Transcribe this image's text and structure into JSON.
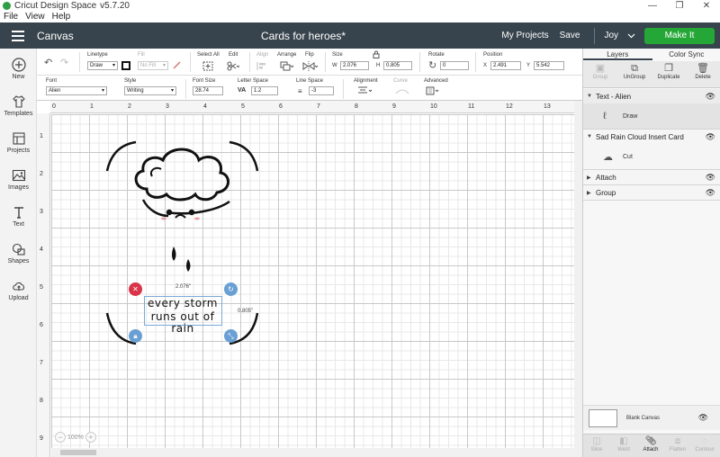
{
  "window": {
    "title": "Cricut Design Space",
    "version": "v5.7.20",
    "controls": [
      "—",
      "❐",
      "✕"
    ]
  },
  "menu": [
    "File",
    "View",
    "Help"
  ],
  "header": {
    "section": "Canvas",
    "doc_title": "Cards for heroes*",
    "my_projects": "My Projects",
    "save": "Save",
    "user": "Joy",
    "make_it": "Make It",
    "accent": "#25a737",
    "bar_color": "#38444d"
  },
  "leftnav": [
    {
      "label": "New",
      "icon": "plus-circle-icon"
    },
    {
      "label": "Templates",
      "icon": "shirt-icon"
    },
    {
      "label": "Projects",
      "icon": "projects-icon"
    },
    {
      "label": "Images",
      "icon": "image-icon"
    },
    {
      "label": "Text",
      "icon": "text-icon"
    },
    {
      "label": "Shapes",
      "icon": "shapes-icon"
    },
    {
      "label": "Upload",
      "icon": "upload-icon"
    }
  ],
  "toolbar1": {
    "linetype_label": "Linetype",
    "linetype_value": "Draw",
    "fill_label": "Fill",
    "fill_value": "No Fill",
    "select_all": "Select All",
    "edit": "Edit",
    "align": "Align",
    "arrange": "Arrange",
    "flip": "Flip",
    "size_label": "Size",
    "w_label": "W",
    "w_value": "2.076",
    "h_label": "H",
    "h_value": "0.805",
    "rotate_label": "Rotate",
    "rotate_value": "0",
    "position_label": "Position",
    "x_label": "X",
    "x_value": "2.491",
    "y_label": "Y",
    "y_value": "5.542"
  },
  "toolbar2": {
    "font_label": "Font",
    "font_value": "Alien",
    "style_label": "Style",
    "style_value": "Writing",
    "font_size_label": "Font Size",
    "font_size_value": "28.74",
    "letter_space_label": "Letter Space",
    "letter_space_value": "1.2",
    "line_space_label": "Line Space",
    "line_space_value": "-3",
    "alignment_label": "Alignment",
    "curve_label": "Curve",
    "advanced_label": "Advanced"
  },
  "ruler": {
    "top": [
      "0",
      "1",
      "2",
      "3",
      "4",
      "5",
      "6",
      "7",
      "8",
      "9",
      "10",
      "11",
      "12",
      "13"
    ],
    "left": [
      "1",
      "2",
      "3",
      "4",
      "5",
      "6",
      "7",
      "8",
      "9"
    ]
  },
  "canvas": {
    "text_line1": "every storm",
    "text_line2": "runs out of rain",
    "width_label": "2.076\"",
    "height_label": "0.805\"",
    "zoom": "100%",
    "delete_color": "#d9344a",
    "handle_color": "#6a9fd4"
  },
  "rightpanel": {
    "tab_layers": "Layers",
    "tab_color_sync": "Color Sync",
    "tools": [
      "Group",
      "UnGroup",
      "Duplicate",
      "Delete"
    ],
    "layers": [
      {
        "name": "Text - Alien",
        "child": "Draw"
      },
      {
        "name": "Sad Rain Cloud Insert Card",
        "child": "Cut"
      },
      {
        "name": "Attach"
      },
      {
        "name": "Group"
      }
    ],
    "blank_canvas": "Blank Canvas",
    "bottom_tools": [
      "Slice",
      "Weld",
      "Attach",
      "Flatten",
      "Contour"
    ]
  }
}
